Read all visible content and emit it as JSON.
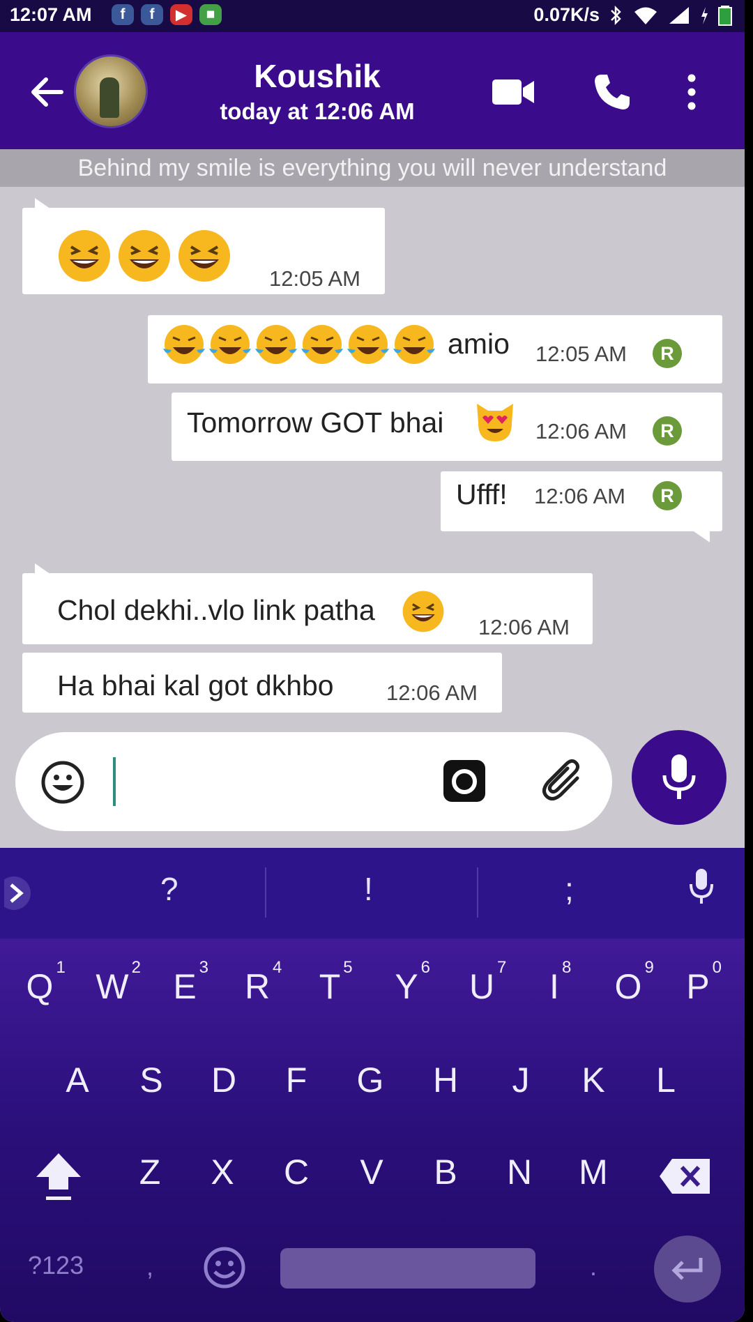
{
  "status_bar": {
    "time": "12:07 AM",
    "notification_icons": [
      "facebook-icon",
      "facebook-icon",
      "youtube-icon",
      "app-icon"
    ],
    "speed": "0.07K/s"
  },
  "header": {
    "contact_name": "Koushik",
    "last_seen": "today at 12:06 AM"
  },
  "status_text": "Behind my smile is everything you will never understand",
  "messages": [
    {
      "direction": "in",
      "text": "",
      "emoji": [
        "laughing",
        "laughing",
        "laughing"
      ],
      "time": "12:05 AM"
    },
    {
      "direction": "out",
      "text": "amio",
      "emoji_before": [
        "tears-of-joy",
        "tears-of-joy",
        "tears-of-joy",
        "tears-of-joy",
        "tears-of-joy",
        "tears-of-joy"
      ],
      "time": "12:05 AM",
      "receipt": "R"
    },
    {
      "direction": "out",
      "text": "Tomorrow GOT bhai",
      "emoji_after": [
        "heart-eyes-cat"
      ],
      "time": "12:06 AM",
      "receipt": "R"
    },
    {
      "direction": "out",
      "text": "Ufff!",
      "time": "12:06 AM",
      "receipt": "R"
    },
    {
      "direction": "in",
      "text": "Chol dekhi..vlo link patha",
      "emoji_after": [
        "laughing"
      ],
      "time": "12:06 AM"
    },
    {
      "direction": "in",
      "text": "Ha bhai kal got dkhbo",
      "time": "12:06 AM"
    }
  ],
  "composer": {
    "input_value": ""
  },
  "keyboard": {
    "suggestions": [
      "?",
      "!",
      ";"
    ],
    "row1": [
      "Q",
      "W",
      "E",
      "R",
      "T",
      "Y",
      "U",
      "I",
      "O",
      "P"
    ],
    "row1_hints": [
      "1",
      "2",
      "3",
      "4",
      "5",
      "6",
      "7",
      "8",
      "9",
      "0"
    ],
    "row2": [
      "A",
      "S",
      "D",
      "F",
      "G",
      "H",
      "J",
      "K",
      "L"
    ],
    "row3": [
      "Z",
      "X",
      "C",
      "V",
      "B",
      "N",
      "M"
    ],
    "symbols_key": "?123",
    "comma_key": ",",
    "period_key": "."
  },
  "colors": {
    "header": "#3a0c8c",
    "chat_background": "#cbc8cf",
    "keyboard": "#2a0f7a",
    "receipt_badge": "#6a9a3a"
  }
}
